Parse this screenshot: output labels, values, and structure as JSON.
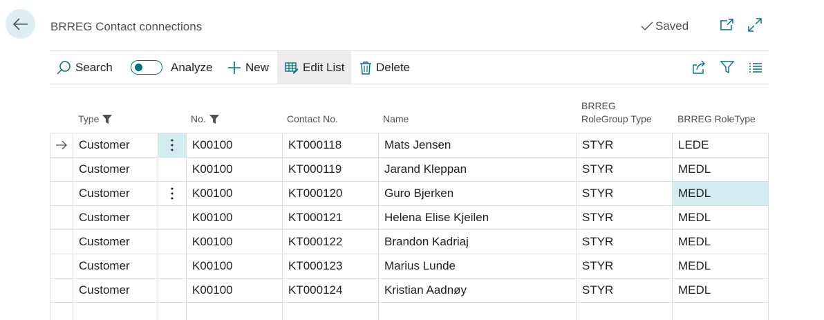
{
  "header": {
    "title": "BRREG Contact connections",
    "saved_label": "Saved"
  },
  "actions": {
    "search": "Search",
    "analyze": "Analyze",
    "new": "New",
    "edit_list": "Edit List",
    "delete": "Delete"
  },
  "columns": {
    "type": "Type",
    "no": "No.",
    "contact_no": "Contact No.",
    "name": "Name",
    "rolegroup_line1": "BRREG",
    "rolegroup_line2": "RoleGroup Type",
    "roletype": "BRREG RoleType"
  },
  "rows": [
    {
      "type": "Customer",
      "no": "K00100",
      "contact_no": "KT000118",
      "name": "Mats Jensen",
      "rolegroup": "STYR",
      "roletype": "LEDE"
    },
    {
      "type": "Customer",
      "no": "K00100",
      "contact_no": "KT000119",
      "name": "Jarand Kleppan",
      "rolegroup": "STYR",
      "roletype": "MEDL"
    },
    {
      "type": "Customer",
      "no": "K00100",
      "contact_no": "KT000120",
      "name": "Guro Bjerken",
      "rolegroup": "STYR",
      "roletype": "MEDL"
    },
    {
      "type": "Customer",
      "no": "K00100",
      "contact_no": "KT000121",
      "name": "Helena Elise Kjeilen",
      "rolegroup": "STYR",
      "roletype": "MEDL"
    },
    {
      "type": "Customer",
      "no": "K00100",
      "contact_no": "KT000122",
      "name": "Brandon Kadriaj",
      "rolegroup": "STYR",
      "roletype": "MEDL"
    },
    {
      "type": "Customer",
      "no": "K00100",
      "contact_no": "KT000123",
      "name": "Marius Lunde",
      "rolegroup": "STYR",
      "roletype": "MEDL"
    },
    {
      "type": "Customer",
      "no": "K00100",
      "contact_no": "KT000124",
      "name": "Kristian Aadnøy",
      "rolegroup": "STYR",
      "roletype": "MEDL"
    }
  ],
  "icons": {
    "back": "arrow-left-icon",
    "saved": "checkmark-icon",
    "open_new_window": "open-in-new-window-icon",
    "expand": "expand-icon",
    "search": "search-icon",
    "new": "plus-icon",
    "edit_list": "edit-list-icon",
    "delete": "trash-icon",
    "share": "share-icon",
    "filter": "filter-icon",
    "list_view": "list-view-icon",
    "row_marker": "arrow-right-icon",
    "row_menu": "more-vertical-icon",
    "column_filter": "filter-funnel-icon"
  },
  "colors": {
    "accent": "#00707a",
    "selected_cell": "#d3ecf1",
    "back_button_bg": "#dceef2",
    "active_action_bg": "#ececec"
  }
}
